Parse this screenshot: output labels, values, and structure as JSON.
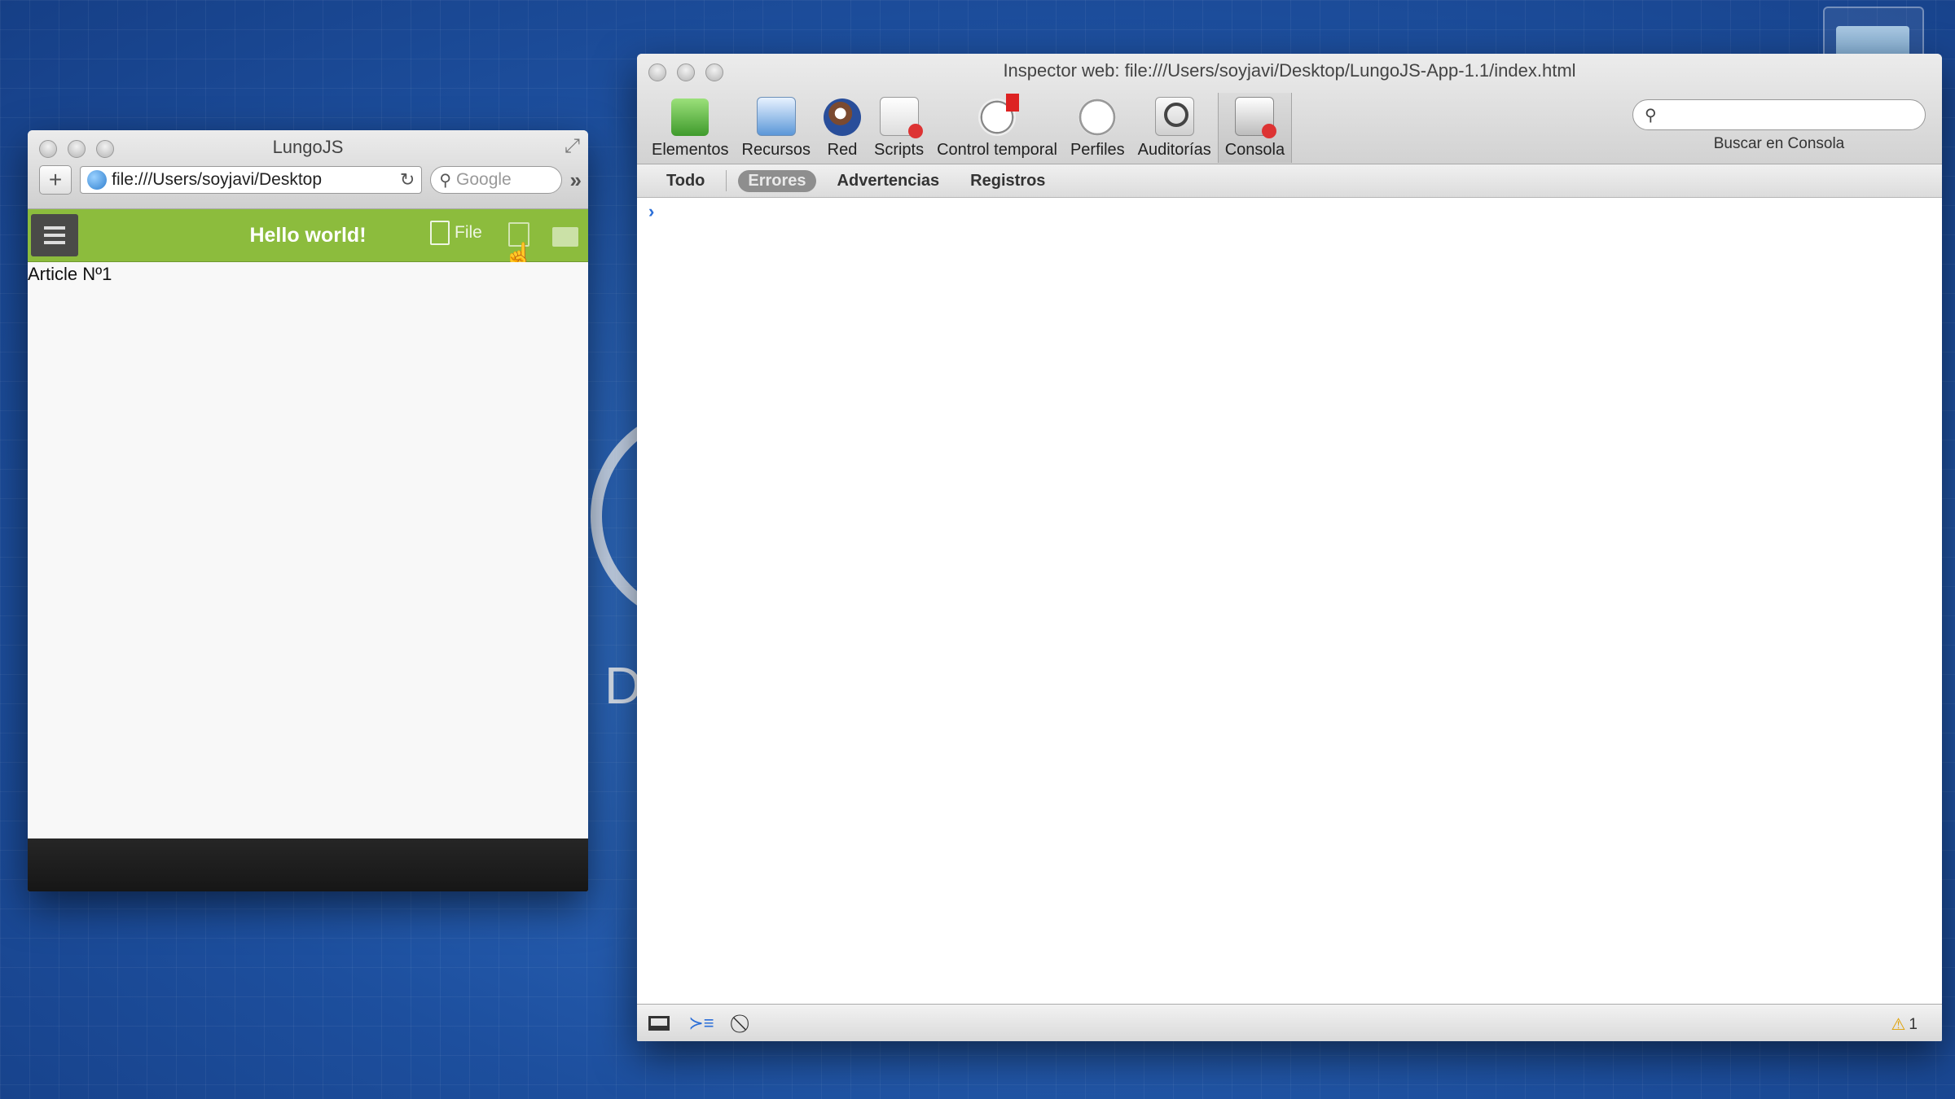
{
  "browser": {
    "title": "LungoJS",
    "url": "file:///Users/soyjavi/Desktop",
    "search_placeholder": "Google",
    "app": {
      "header_title": "Hello world!",
      "file_label": "File",
      "article": "Article Nº1"
    }
  },
  "inspector": {
    "title": "Inspector web: file:///Users/soyjavi/Desktop/LungoJS-App-1.1/index.html",
    "tools": [
      {
        "label": "Elementos",
        "icon": "elements-icon"
      },
      {
        "label": "Recursos",
        "icon": "resources-icon"
      },
      {
        "label": "Red",
        "icon": "network-icon"
      },
      {
        "label": "Scripts",
        "icon": "scripts-icon"
      },
      {
        "label": "Control temporal",
        "icon": "timeline-icon"
      },
      {
        "label": "Perfiles",
        "icon": "profiles-icon"
      },
      {
        "label": "Auditorías",
        "icon": "audits-icon"
      },
      {
        "label": "Consola",
        "icon": "console-icon",
        "active": true
      }
    ],
    "search_label": "Buscar en Consola",
    "filters": [
      {
        "label": "Todo"
      },
      {
        "label": "Errores",
        "active": true
      },
      {
        "label": "Advertencias"
      },
      {
        "label": "Registros"
      }
    ],
    "prompt": "›",
    "warning_count": "1"
  },
  "colors": {
    "lungo_header": "#8cbc3d",
    "desktop_blue": "#2a64b8"
  }
}
